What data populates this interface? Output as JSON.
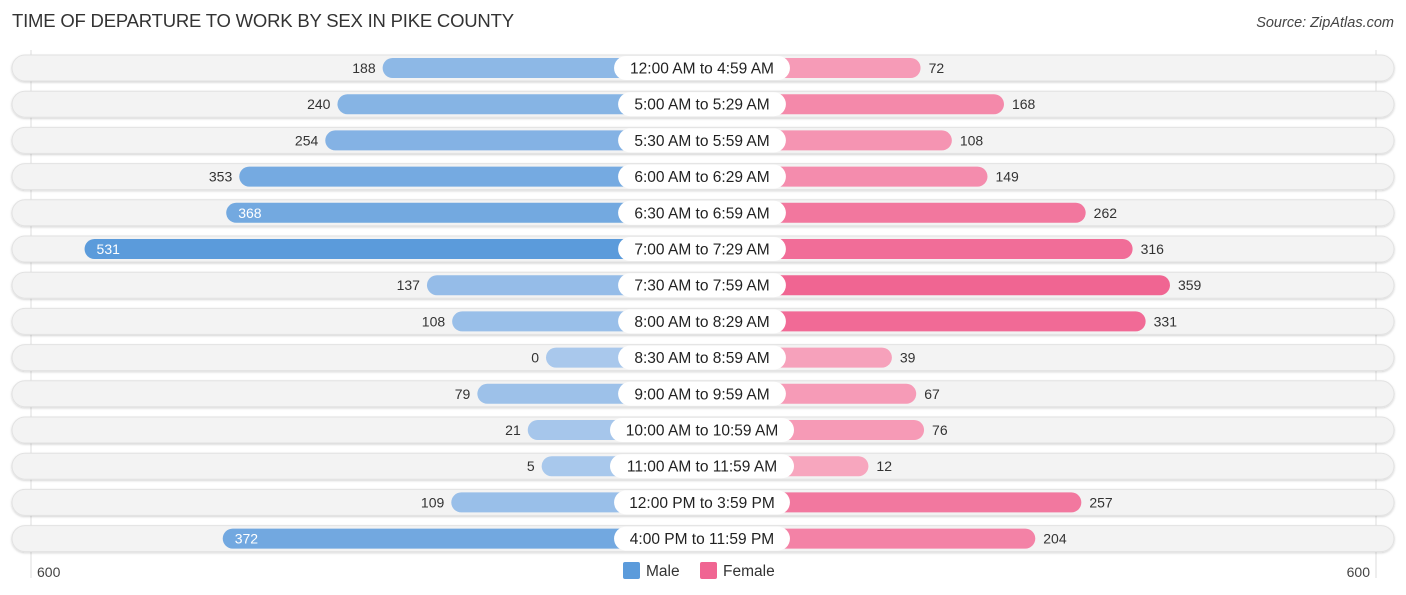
{
  "header": {
    "title": "TIME OF DEPARTURE TO WORK BY SEX IN PIKE COUNTY",
    "source": "Source: ZipAtlas.com"
  },
  "colors": {
    "male_dark": "#5b9bdb",
    "male_light": "#a9c8ec",
    "female_dark": "#f06592",
    "female_light": "#f7a8c0",
    "row_bg": "#f3f3f3",
    "label_bg": "#ffffff"
  },
  "chart_data": {
    "type": "bar",
    "orientation": "horizontal-diverging",
    "title": "TIME OF DEPARTURE TO WORK BY SEX IN PIKE COUNTY",
    "categories": [
      "12:00 AM to 4:59 AM",
      "5:00 AM to 5:29 AM",
      "5:30 AM to 5:59 AM",
      "6:00 AM to 6:29 AM",
      "6:30 AM to 6:59 AM",
      "7:00 AM to 7:29 AM",
      "7:30 AM to 7:59 AM",
      "8:00 AM to 8:29 AM",
      "8:30 AM to 8:59 AM",
      "9:00 AM to 9:59 AM",
      "10:00 AM to 10:59 AM",
      "11:00 AM to 11:59 AM",
      "12:00 PM to 3:59 PM",
      "4:00 PM to 11:59 PM"
    ],
    "series": [
      {
        "name": "Male",
        "side": "left",
        "values": [
          188,
          240,
          254,
          353,
          368,
          531,
          137,
          108,
          0,
          79,
          21,
          5,
          109,
          372
        ]
      },
      {
        "name": "Female",
        "side": "right",
        "values": [
          72,
          168,
          108,
          149,
          262,
          316,
          359,
          331,
          39,
          67,
          76,
          12,
          257,
          204
        ]
      }
    ],
    "axis": {
      "left_label": "600",
      "right_label": "600",
      "range": [
        0,
        600
      ]
    },
    "legend": {
      "position": "bottom-center",
      "entries": [
        "Male",
        "Female"
      ]
    },
    "grid": false
  }
}
